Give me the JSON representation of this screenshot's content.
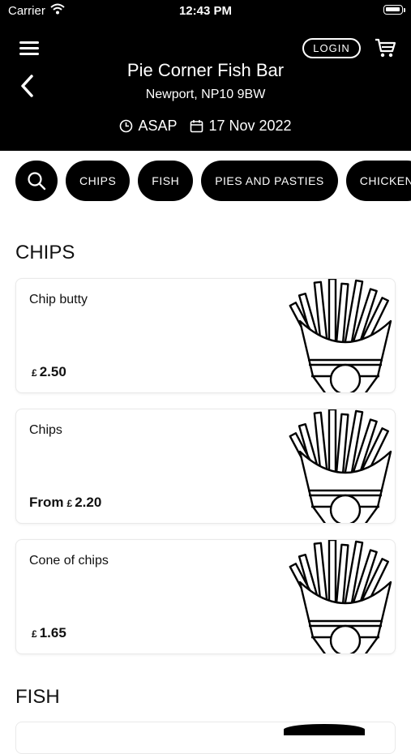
{
  "status": {
    "carrier": "Carrier",
    "time": "12:43 PM"
  },
  "header": {
    "login_label": "LOGIN",
    "title": "Pie Corner Fish Bar",
    "subtitle": "Newport, NP10 9BW",
    "time_label": "ASAP",
    "date_label": "17 Nov 2022"
  },
  "categories": [
    "CHIPS",
    "FISH",
    "PIES AND PASTIES",
    "CHICKEN"
  ],
  "sections": [
    {
      "title": "CHIPS",
      "items": [
        {
          "name": "Chip butty",
          "prefix": "",
          "currency": "£",
          "price": "2.50",
          "image": "fries-icon"
        },
        {
          "name": "Chips",
          "prefix": "From",
          "currency": "£",
          "price": "2.20",
          "image": "fries-icon"
        },
        {
          "name": "Cone of chips",
          "prefix": "",
          "currency": "£",
          "price": "1.65",
          "image": "fries-icon"
        }
      ]
    },
    {
      "title": "FISH",
      "items": []
    }
  ],
  "colors": {
    "header_bg": "#000000",
    "header_text": "#ffffff",
    "chip_bg": "#000000"
  }
}
